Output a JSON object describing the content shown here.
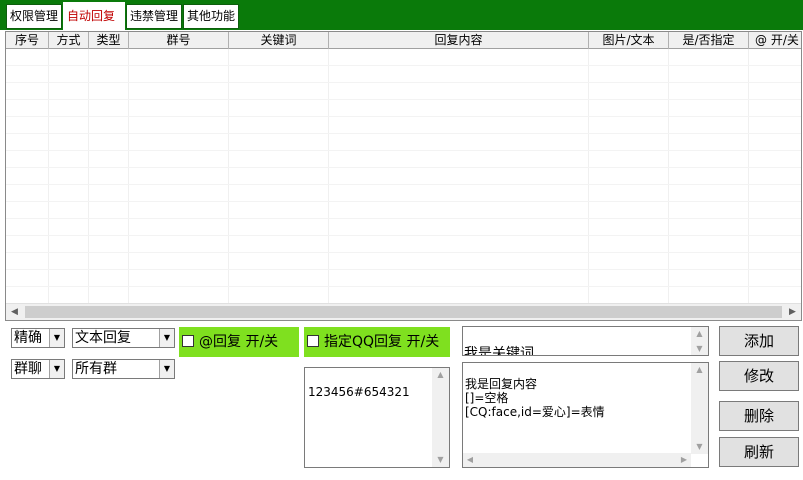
{
  "tabs": [
    {
      "label": "权限管理"
    },
    {
      "label": "自动回复"
    },
    {
      "label": "违禁管理"
    },
    {
      "label": "其他功能"
    }
  ],
  "table": {
    "columns": [
      "序号",
      "方式",
      "类型",
      "群号",
      "关键词",
      "回复内容",
      "图片/文本",
      "是/否指定",
      "@ 开/关"
    ]
  },
  "controls": {
    "match_mode": "精确",
    "reply_type": "文本回复",
    "chat_type": "群聊",
    "group_scope": "所有群",
    "at_reply_label": "@回复 开/关",
    "specify_qq_label": "指定QQ回复 开/关",
    "qq_list": "123456#654321",
    "keyword_value": "我是关键词",
    "reply_content": "我是回复内容\n[]=空格\n[CQ:face,id=爱心]=表情"
  },
  "buttons": {
    "add": "添加",
    "modify": "修改",
    "delete": "删除",
    "refresh": "刷新"
  },
  "colors": {
    "tabbar_bg": "#0a7a0a",
    "active_tab_text": "#c00000",
    "toggle_bg": "#7fe01f"
  }
}
